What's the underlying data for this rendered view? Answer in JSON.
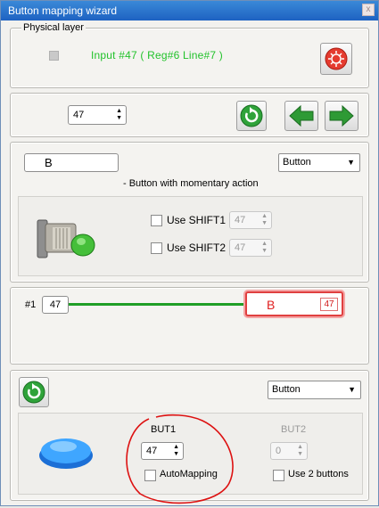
{
  "window": {
    "title": "Button mapping wizard",
    "close_glyph": "x"
  },
  "physical": {
    "legend": "Physical layer",
    "input_text": "Input #47  ( Reg#6   Line#7 )",
    "input_color": "#22c22b"
  },
  "nav": {
    "index_value": "47"
  },
  "mapping": {
    "name_value": "B",
    "type_value": "Button",
    "description": "- Button with momentary action",
    "shift1_label": "Use SHIFT1",
    "shift1_value": "47",
    "shift2_label": "Use SHIFT2",
    "shift2_value": "47"
  },
  "line": {
    "source_label": "#1",
    "source_value": "47",
    "target_label": "B",
    "target_value": "47",
    "line_color": "#1f9e26",
    "target_color": "#e02020"
  },
  "bottom": {
    "type_value": "Button",
    "but1_label": "BUT1",
    "but1_value": "47",
    "automapping_label": "AutoMapping",
    "but2_label": "BUT2",
    "but2_value": "0",
    "use2_label": "Use 2 buttons",
    "annotation_color": "#dd1111"
  },
  "icons": {
    "reset": "red-reset-icon",
    "refresh": "green-refresh-icon",
    "prev": "green-left-arrow-icon",
    "next": "green-right-arrow-icon",
    "pushbutton": "pushbutton-photo-icon",
    "led": "blue-button-icon"
  }
}
